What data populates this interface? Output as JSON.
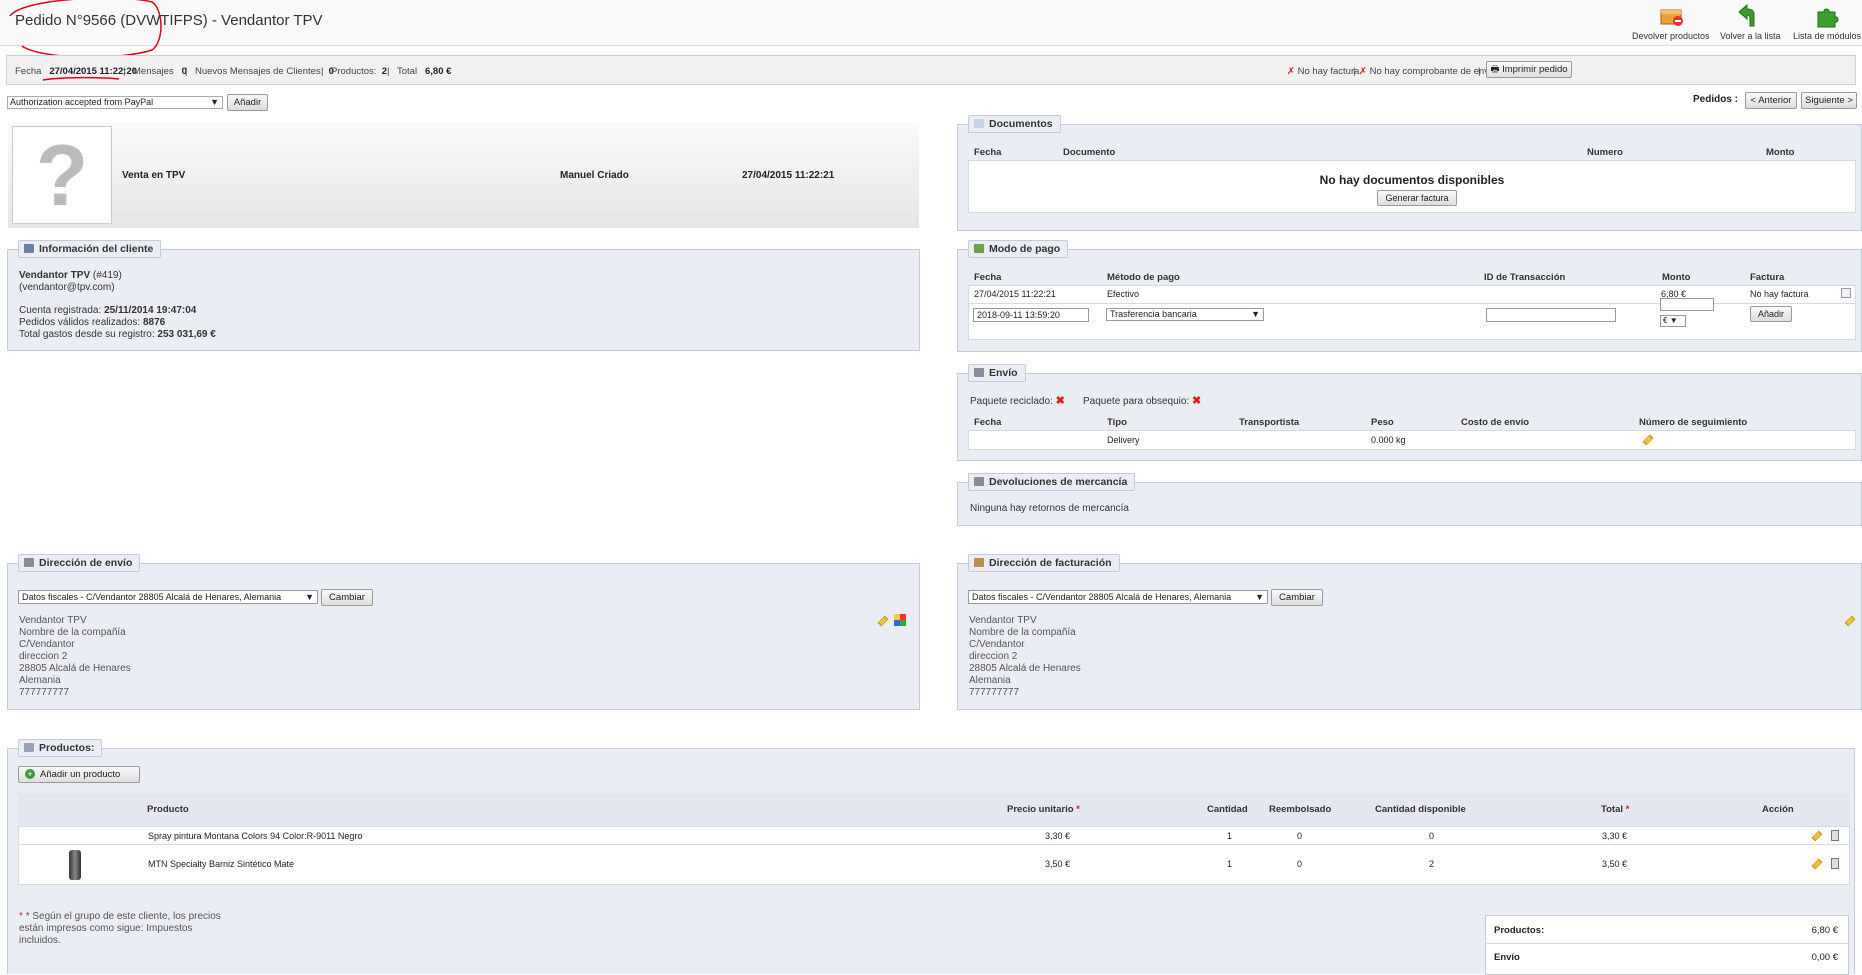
{
  "header": {
    "title": "Pedido N°9566 (DVWTIFPS) - Vendantor TPV",
    "toolbar": {
      "return_label": "Devolver productos",
      "back_label": "Volver a la lista",
      "modules_label": "Lista de módulos"
    }
  },
  "summary": {
    "date_label": "Fecha",
    "date_value": "27/04/2015 11:22:20",
    "messages_label": "Mensajes",
    "messages_value": "0",
    "new_messages_label": "Nuevos Mensajes de Clientes:",
    "new_messages_value": "0",
    "products_label": "Productos:",
    "products_value": "2",
    "total_label": "Total",
    "total_value": "6,80 €",
    "no_invoice": "No hay factura",
    "no_delivery_slip": "No hay comprobante de envío",
    "print_label": "Imprimir pedido",
    "sep": "|"
  },
  "status": {
    "selected": "Authorization accepted from PayPal",
    "add_label": "Añadir"
  },
  "orders_nav": {
    "label": "Pedidos :",
    "prev_label": "< Anterior",
    "next_label": "Siguiente >"
  },
  "history": {
    "state": "Venta en TPV",
    "employee": "Manuel Criado",
    "date": "27/04/2015 11:22:21",
    "placeholder": "?"
  },
  "customer": {
    "legend": "Información del cliente",
    "name": "Vendantor TPV",
    "id": "(#419)",
    "email": "(vendantor@tpv.com)",
    "registered_label": "Cuenta registrada:",
    "registered_value": "25/11/2014 19:47:04",
    "valid_orders_label": "Pedidos válidos realizados:",
    "valid_orders_value": "8876",
    "total_spent_label": "Total gastos desde su registro:",
    "total_spent_value": "253 031,69 €"
  },
  "documents": {
    "legend": "Documentos",
    "headers": [
      "Fecha",
      "Documento",
      "Numero",
      "Monto"
    ],
    "empty": "No hay documentos disponibles",
    "generate_label": "Generar factura"
  },
  "payment": {
    "legend": "Modo de pago",
    "headers": [
      "Fecha",
      "Método de pago",
      "ID de Transacción",
      "Monto",
      "Factura"
    ],
    "row": {
      "date": "27/04/2015 11:22:21",
      "method": "Efectivo",
      "txn": "",
      "amount": "6,80 €",
      "invoice": "No hay factura"
    },
    "new_date": "2018-09-11 13:59:20",
    "new_method": "Trasferencia bancaria",
    "currency": "€",
    "add_label": "Añadir"
  },
  "shipping": {
    "legend": "Envío",
    "recycled_label": "Paquete reciclado:",
    "gift_label": "Paquete para obsequio:",
    "cross": "✖",
    "headers": [
      "Fecha",
      "Tipo",
      "Transportista",
      "Peso",
      "Costo de envío",
      "Número de seguimiento"
    ],
    "row": {
      "date": "",
      "type": "Delivery",
      "carrier": "",
      "weight": "0.000 kg",
      "cost": ""
    }
  },
  "returns": {
    "legend": "Devoluciones de mercancía",
    "empty": "Ninguna hay retornos de mercancía"
  },
  "shipping_address": {
    "legend": "Dirección de envío",
    "select": "Datos fiscales - C/Vendantor 28805 Alcalá de Henares, Alemania",
    "change_label": "Cambiar",
    "lines": [
      "Vendantor TPV",
      "Nombre de la compañía",
      "C/Vendantor",
      "direccion 2",
      "28805 Alcalá de Henares",
      "Alemania",
      "777777777"
    ]
  },
  "billing_address": {
    "legend": "Dirección de facturación",
    "select": "Datos fiscales - C/Vendantor 28805 Alcalá de Henares, Alemania",
    "change_label": "Cambiar",
    "lines": [
      "Vendantor TPV",
      "Nombre de la compañía",
      "C/Vendantor",
      "direccion 2",
      "28805 Alcalá de Henares",
      "Alemania",
      "777777777"
    ]
  },
  "products": {
    "legend": "Productos:",
    "add_label": "Añadir un producto",
    "headers": {
      "product": "Producto",
      "unit_price": "Precio unitario",
      "qty": "Cantidad",
      "refunded": "Reembolsado",
      "available": "Cantidad disponible",
      "total": "Total",
      "action": "Acción"
    },
    "star": "*",
    "rows": [
      {
        "name": "Spray pintura Montana Colors 94 Color:R-9011 Negro",
        "price": "3,30 €",
        "qty": "1",
        "refunded": "0",
        "available": "0",
        "total": "3,30 €"
      },
      {
        "name": "MTN Specialty Barniz Sintético Mate",
        "price": "3,50 €",
        "qty": "1",
        "refunded": "0",
        "available": "2",
        "total": "3,50 €"
      }
    ],
    "note_lines": [
      "* Según el grupo de este cliente, los precios",
      "están impresos como sigue: Impuestos",
      "incluidos."
    ],
    "totals": [
      {
        "label": "Productos:",
        "value": "6,80 €"
      },
      {
        "label": "Envío",
        "value": "0,00 €"
      }
    ]
  },
  "colors": {
    "panel_bg": "#ebedf4",
    "panel_border": "#c4cbd8",
    "annotation": "#e0001a"
  }
}
